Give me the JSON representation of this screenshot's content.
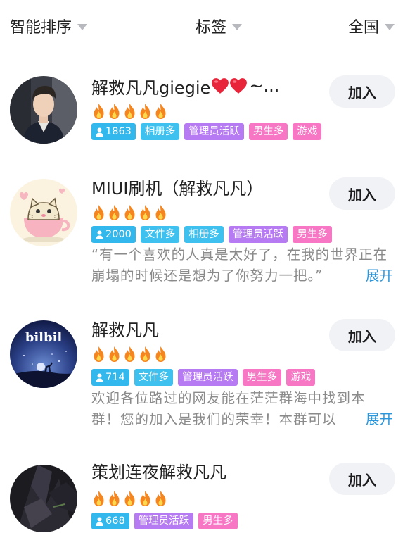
{
  "filters": [
    {
      "label": "智能排序"
    },
    {
      "label": "标签"
    },
    {
      "label": "全国"
    }
  ],
  "groups": [
    {
      "name": "解救凡凡giegie",
      "name_suffix": "~...",
      "hearts": 2,
      "fire_level": 5,
      "member_count": "1863",
      "tags": [
        "相册多",
        "管理员活跃",
        "男生多",
        "游戏"
      ],
      "join_label": "加入"
    },
    {
      "name": "MIUI刷机（解救凡凡）",
      "fire_level": 5,
      "member_count": "2000",
      "tags": [
        "文件多",
        "相册多",
        "管理员活跃",
        "男生多"
      ],
      "join_label": "加入",
      "description_line1": "“有一个喜欢的人真是太好了，在我的世界正在",
      "description_line2": "崩塌的时候还是想为了你努力一把。”",
      "expand_label": "展开"
    },
    {
      "name": "解救凡凡",
      "avatar_text": "bilbil",
      "fire_level": 5,
      "member_count": "714",
      "tags": [
        "文件多",
        "管理员活跃",
        "男生多",
        "游戏"
      ],
      "join_label": "加入",
      "description_line1": "欢迎各位路过的网友能在茫茫群海中找到本",
      "description_line2": "群！您的加入是我们的荣幸！本群可以",
      "expand_label": "展开"
    },
    {
      "name": "策划连夜解救凡凡",
      "fire_level": 5,
      "member_count": "668",
      "tags": [
        "管理员活跃",
        "男生多"
      ],
      "join_label": "加入"
    }
  ],
  "colors": {
    "tag_count": "#32b8ec",
    "tag_blue": "#3fc1f0",
    "tag_purple": "#b67af2",
    "tag_pink": "#f777c4",
    "fire": "#f5861f",
    "heart": "#e8243a",
    "expand_link": "#2a96dc"
  }
}
